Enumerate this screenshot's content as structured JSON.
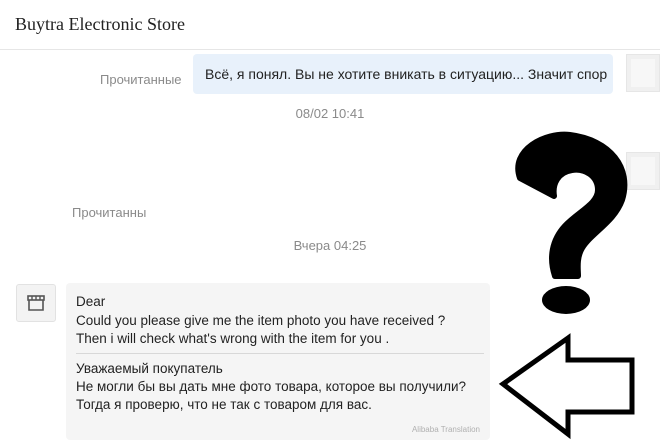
{
  "header": {
    "title": "Buytra Electronic Store"
  },
  "messages": {
    "first": {
      "status": "Прочитанные",
      "text": "Всё, я понял. Вы не хотите вникать в ситуацию... Значит спор"
    },
    "timestamp_1": "08/02 10:41",
    "second": {
      "status": "Прочитанны"
    },
    "timestamp_2": "Вчера 04:25",
    "reply": {
      "original_lines": [
        "Dear",
        "Could you please give me the item photo you have received ?",
        "Then i will check what's wrong with the item for you ."
      ],
      "translated_lines": [
        "Уважаемый покупатель",
        "Не могли бы вы дать мне фото товара, которое вы получили?",
        "Тогда я проверю, что не так с товаром для вас."
      ],
      "translation_note": "Alibaba Translation"
    }
  },
  "overlay": {
    "question_mark_color": "#000000",
    "arrow_color": "#000000",
    "icons": [
      "question-mark",
      "arrow-left"
    ]
  }
}
